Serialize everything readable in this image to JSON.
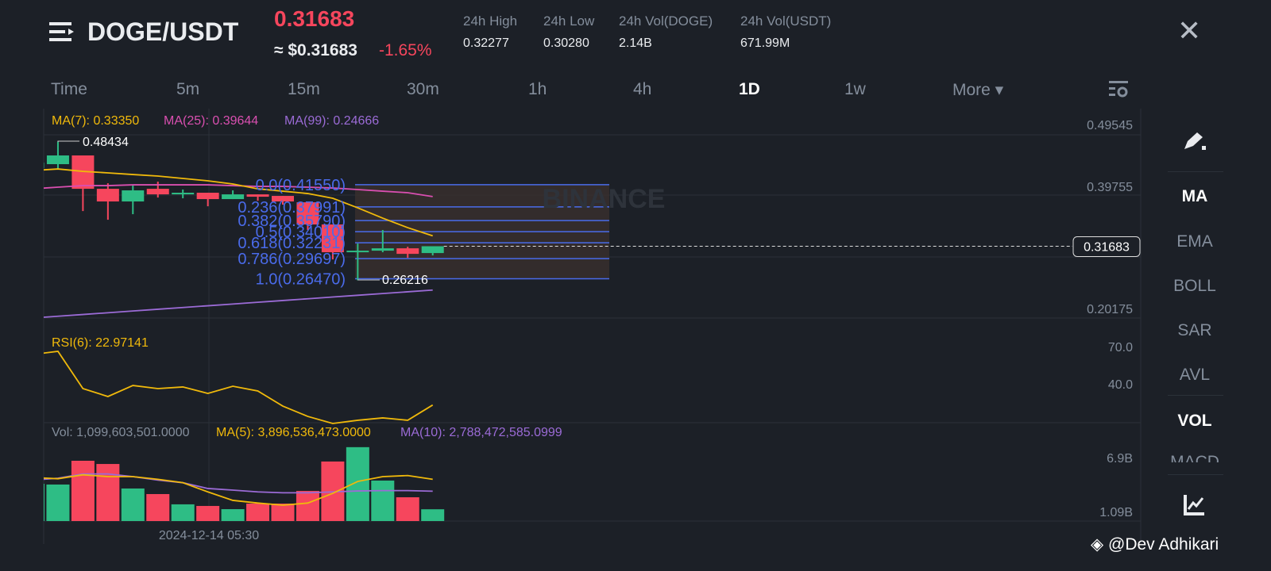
{
  "header": {
    "pair": "DOGE/USDT",
    "price": "0.31683",
    "approx": "≈ $0.31683",
    "change": "-1.65%",
    "stats": [
      {
        "label": "24h High",
        "value": "0.32277"
      },
      {
        "label": "24h Low",
        "value": "0.30280"
      },
      {
        "label": "24h Vol(DOGE)",
        "value": "2.14B"
      },
      {
        "label": "24h Vol(USDT)",
        "value": "671.99M"
      }
    ],
    "close_icon": "✕"
  },
  "timeframes": [
    {
      "label": "Time"
    },
    {
      "label": "5m"
    },
    {
      "label": "15m"
    },
    {
      "label": "30m"
    },
    {
      "label": "1h"
    },
    {
      "label": "4h"
    },
    {
      "label": "1D",
      "active": true
    },
    {
      "label": "1w"
    },
    {
      "label": "More ▾"
    }
  ],
  "sidebar": {
    "items": [
      "MA",
      "EMA",
      "BOLL",
      "SAR",
      "AVL",
      "VOL",
      "MACD"
    ]
  },
  "watermark": {
    "logo_text": "BINANCE",
    "credit": "@Dev Adhikari"
  },
  "colors": {
    "up": "#2ebd85",
    "down": "#f6465d",
    "ma7": "#f0b90b",
    "ma25": "#d94fb0",
    "ma99": "#9b6bd6",
    "fib": "#4a6bea"
  },
  "chart_data": {
    "type": "candlestick",
    "price_axis": {
      "ticks": [
        "0.49545",
        "0.39755",
        "0.20175"
      ],
      "range": [
        0.20175,
        0.49545
      ],
      "current_label": "0.31683",
      "current": 0.31683
    },
    "indicators": {
      "ma7": "MA(7): 0.33350",
      "ma25": "MA(25): 0.39644",
      "ma99": "MA(99): 0.24666"
    },
    "high_label": "0.48434",
    "low_label": "0.26216",
    "candles": [
      {
        "o": 0.442,
        "h": 0.4573,
        "l": 0.4382,
        "c": 0.4509
      },
      {
        "o": 0.4484,
        "h": 0.48434,
        "l": 0.4407,
        "c": 0.4624
      },
      {
        "o": 0.4624,
        "h": 0.4624,
        "l": 0.3733,
        "c": 0.4089
      },
      {
        "o": 0.4089,
        "h": 0.4178,
        "l": 0.3593,
        "c": 0.3886
      },
      {
        "o": 0.3886,
        "h": 0.414,
        "l": 0.3682,
        "c": 0.4064
      },
      {
        "o": 0.4089,
        "h": 0.4204,
        "l": 0.3949,
        "c": 0.4
      },
      {
        "o": 0.4,
        "h": 0.4077,
        "l": 0.3937,
        "c": 0.4026
      },
      {
        "o": 0.4026,
        "h": 0.4026,
        "l": 0.3809,
        "c": 0.3924
      },
      {
        "o": 0.3924,
        "h": 0.4064,
        "l": 0.3924,
        "c": 0.4
      },
      {
        "o": 0.4,
        "h": 0.4,
        "l": 0.3898,
        "c": 0.3962
      },
      {
        "o": 0.3975,
        "h": 0.3975,
        "l": 0.3835,
        "c": 0.3886
      },
      {
        "o": 0.3873,
        "h": 0.3873,
        "l": 0.3428,
        "c": 0.3517
      },
      {
        "o": 0.3517,
        "h": 0.3517,
        "l": 0.2957,
        "c": 0.3072
      },
      {
        "o": 0.3072,
        "h": 0.3211,
        "l": 0.26216,
        "c": 0.3097
      },
      {
        "o": 0.3097,
        "h": 0.3428,
        "l": 0.3072,
        "c": 0.3135
      },
      {
        "o": 0.3135,
        "h": 0.316,
        "l": 0.2982,
        "c": 0.3046
      },
      {
        "o": 0.3059,
        "h": 0.3135,
        "l": 0.3021,
        "c": 0.31683
      }
    ],
    "ma7": [
      0.4382,
      0.4407,
      0.4369,
      0.4344,
      0.4318,
      0.4293,
      0.4255,
      0.4217,
      0.4166,
      0.4089,
      0.4051,
      0.4013,
      0.3937,
      0.3784,
      0.3619,
      0.3466,
      0.3335
    ],
    "ma25": [
      0.4089,
      0.4115,
      0.414,
      0.414,
      0.4153,
      0.4153,
      0.4153,
      0.4153,
      0.414,
      0.4127,
      0.4127,
      0.4115,
      0.4102,
      0.4077,
      0.4051,
      0.4026,
      0.3964
    ],
    "ma99": [
      0.2018,
      0.2046,
      0.2074,
      0.2102,
      0.213,
      0.2158,
      0.2186,
      0.2214,
      0.2242,
      0.227,
      0.2298,
      0.2326,
      0.2354,
      0.2382,
      0.241,
      0.2438,
      0.2466
    ],
    "fib": [
      {
        "label": "0.0(0.41550)",
        "v": 0.4155
      },
      {
        "label": "0.236(0.37991)",
        "v": 0.37991
      },
      {
        "label": "0.382(0.35790)",
        "v": 0.3579
      },
      {
        "label": "0.5(0.34010)",
        "v": 0.3401
      },
      {
        "label": "0.618(0.32231)",
        "v": 0.32231
      },
      {
        "label": "0.786(0.29697)",
        "v": 0.29697
      },
      {
        "label": "1.0(0.26470)",
        "v": 0.2647
      }
    ],
    "rsi": {
      "label": "RSI(6): 22.97141",
      "ticks": [
        "70.0",
        "40.0"
      ],
      "values": [
        63.6,
        66.2,
        36.2,
        29.8,
        38.7,
        36.2,
        37.5,
        32.3,
        38.1,
        34.3,
        22.1,
        13.8,
        8.1,
        10.7,
        12.6,
        10.7,
        22.97
      ]
    },
    "volume": {
      "label": "Vol: 1,099,603,501.0000",
      "ma5_label": "MA(5): 3,896,536,473.0000",
      "ma10_label": "MA(10): 2,788,472,585.0999",
      "ticks": [
        "6.9B",
        "1.09B"
      ],
      "unit": "billions",
      "values": [
        3.48,
        3.41,
        5.63,
        5.33,
        3.04,
        2.52,
        1.56,
        1.41,
        1.11,
        1.63,
        1.63,
        2.81,
        5.56,
        6.9,
        3.78,
        2.22,
        1.0996
      ],
      "ma5": [
        4.07,
        3.95,
        4.32,
        4.15,
        4.15,
        3.9,
        3.58,
        2.72,
        1.93,
        1.68,
        1.48,
        1.68,
        2.59,
        3.7,
        4.15,
        4.25,
        3.8965
      ],
      "ma10": [
        3.83,
        4.0,
        4.4,
        4.4,
        4.15,
        3.83,
        3.58,
        3.04,
        2.89,
        2.72,
        2.64,
        2.64,
        2.72,
        2.81,
        2.84,
        2.84,
        2.7885
      ]
    },
    "x_label": "2024-12-14 05:30"
  }
}
